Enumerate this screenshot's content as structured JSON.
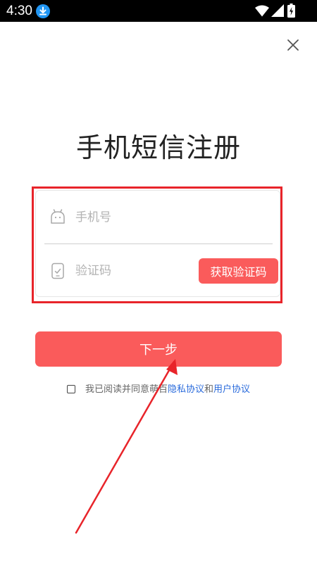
{
  "status_bar": {
    "time": "4:30",
    "icons": [
      "download-icon",
      "wifi-icon",
      "signal-icon",
      "battery-icon"
    ]
  },
  "header": {
    "close_icon": "close-icon"
  },
  "page": {
    "title": "手机短信注册"
  },
  "form": {
    "phone": {
      "icon": "phone-icon",
      "placeholder": "手机号",
      "value": ""
    },
    "code": {
      "icon": "sms-code-icon",
      "placeholder": "验证码",
      "value": "",
      "get_code_label": "获取验证码"
    }
  },
  "actions": {
    "next_label": "下一步"
  },
  "agreement": {
    "prefix": "我已阅读并同意萌百",
    "privacy_link": "隐私协议",
    "conjunction": "和",
    "terms_link": "用户协议",
    "checked": false
  },
  "colors": {
    "accent": "#fa5b5b",
    "highlight_frame": "#e8242a",
    "link": "#2a6bdc",
    "status_bar_bg": "#000000",
    "title_text": "#222222",
    "placeholder_text": "#b3b3b3",
    "annotation_arrow": "#e8242a"
  }
}
